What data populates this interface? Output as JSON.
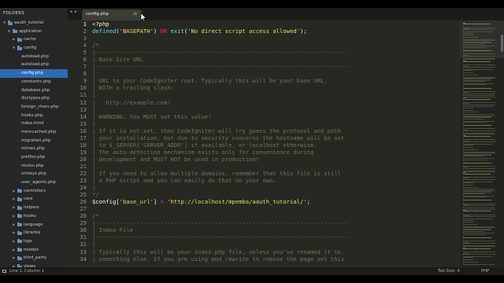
{
  "sidebar": {
    "header": "FOLDERS",
    "items": [
      {
        "label": "aauth_tutorial",
        "depth": 0,
        "open": true,
        "folder": true,
        "selected": false
      },
      {
        "label": "application",
        "depth": 1,
        "open": true,
        "folder": true,
        "selected": false
      },
      {
        "label": "cache",
        "depth": 2,
        "open": false,
        "folder": true,
        "selected": false
      },
      {
        "label": "config",
        "depth": 2,
        "open": true,
        "folder": true,
        "selected": false
      },
      {
        "label": "autoload.php",
        "depth": 3,
        "folder": false,
        "selected": false
      },
      {
        "label": "autoload.php",
        "depth": 3,
        "folder": false,
        "selected": false
      },
      {
        "label": "config.php",
        "depth": 3,
        "folder": false,
        "selected": true
      },
      {
        "label": "constants.php",
        "depth": 3,
        "folder": false,
        "selected": false
      },
      {
        "label": "database.php",
        "depth": 3,
        "folder": false,
        "selected": false
      },
      {
        "label": "doctypes.php",
        "depth": 3,
        "folder": false,
        "selected": false
      },
      {
        "label": "foreign_chars.php",
        "depth": 3,
        "folder": false,
        "selected": false
      },
      {
        "label": "hooks.php",
        "depth": 3,
        "folder": false,
        "selected": false
      },
      {
        "label": "index.html",
        "depth": 3,
        "folder": false,
        "selected": false
      },
      {
        "label": "memcached.php",
        "depth": 3,
        "folder": false,
        "selected": false
      },
      {
        "label": "migration.php",
        "depth": 3,
        "folder": false,
        "selected": false
      },
      {
        "label": "mimes.php",
        "depth": 3,
        "folder": false,
        "selected": false
      },
      {
        "label": "profiler.php",
        "depth": 3,
        "folder": false,
        "selected": false
      },
      {
        "label": "routes.php",
        "depth": 3,
        "folder": false,
        "selected": false
      },
      {
        "label": "smileys.php",
        "depth": 3,
        "folder": false,
        "selected": false
      },
      {
        "label": "user_agents.php",
        "depth": 3,
        "folder": false,
        "selected": false
      },
      {
        "label": "controllers",
        "depth": 2,
        "open": false,
        "folder": true,
        "selected": false
      },
      {
        "label": "core",
        "depth": 2,
        "open": false,
        "folder": true,
        "selected": false
      },
      {
        "label": "helpers",
        "depth": 2,
        "open": false,
        "folder": true,
        "selected": false
      },
      {
        "label": "hooks",
        "depth": 2,
        "open": false,
        "folder": true,
        "selected": false
      },
      {
        "label": "language",
        "depth": 2,
        "open": false,
        "folder": true,
        "selected": false
      },
      {
        "label": "libraries",
        "depth": 2,
        "open": false,
        "folder": true,
        "selected": false
      },
      {
        "label": "logs",
        "depth": 2,
        "open": false,
        "folder": true,
        "selected": false
      },
      {
        "label": "models",
        "depth": 2,
        "open": false,
        "folder": true,
        "selected": false
      },
      {
        "label": "third_party",
        "depth": 2,
        "open": false,
        "folder": true,
        "selected": false
      },
      {
        "label": "views",
        "depth": 2,
        "open": false,
        "folder": true,
        "selected": false
      }
    ]
  },
  "tabbar": {
    "nav": "◂ ▸",
    "tab_label": "config.php",
    "tab_close": "⊠"
  },
  "editor": {
    "active_line": 1,
    "lines": [
      {
        "n": "1",
        "parts": [
          [
            "p",
            "<?php"
          ]
        ]
      },
      {
        "n": "2",
        "parts": [
          [
            "f",
            "defined"
          ],
          [
            "p",
            "("
          ],
          [
            "s",
            "'BASEPATH'"
          ],
          [
            "p",
            ") "
          ],
          [
            "k",
            "OR"
          ],
          [
            "p",
            " "
          ],
          [
            "f",
            "exit"
          ],
          [
            "p",
            "("
          ],
          [
            "s",
            "'No direct script access allowed'"
          ],
          [
            "p",
            ");"
          ]
        ]
      },
      {
        "n": "3",
        "parts": []
      },
      {
        "n": "4",
        "parts": [
          [
            "c",
            "/*"
          ]
        ]
      },
      {
        "n": "5",
        "parts": [
          [
            "c",
            "|--------------------------------------------------------------------------"
          ]
        ]
      },
      {
        "n": "6",
        "parts": [
          [
            "c",
            "| Base Site URL"
          ]
        ]
      },
      {
        "n": "7",
        "parts": [
          [
            "c",
            "|--------------------------------------------------------------------------"
          ]
        ]
      },
      {
        "n": "8",
        "parts": [
          [
            "c",
            "|"
          ]
        ]
      },
      {
        "n": "9",
        "parts": [
          [
            "c",
            "| URL to your CodeIgniter root. Typically this will be your base URL,"
          ]
        ]
      },
      {
        "n": "10",
        "parts": [
          [
            "c",
            "| WITH a trailing slash:"
          ]
        ]
      },
      {
        "n": "11",
        "parts": [
          [
            "c",
            "|"
          ]
        ]
      },
      {
        "n": "12",
        "parts": [
          [
            "c",
            "|   http://example.com/"
          ]
        ]
      },
      {
        "n": "13",
        "parts": [
          [
            "c",
            "|"
          ]
        ]
      },
      {
        "n": "14",
        "parts": [
          [
            "c",
            "| WARNING: You MUST set this value!"
          ]
        ]
      },
      {
        "n": "15",
        "parts": [
          [
            "c",
            "|"
          ]
        ]
      },
      {
        "n": "16",
        "parts": [
          [
            "c",
            "| If it is not set, then CodeIgniter will try guess the protocol and path"
          ]
        ]
      },
      {
        "n": "17",
        "parts": [
          [
            "c",
            "| your installation, but due to security concerns the hostname will be set"
          ]
        ]
      },
      {
        "n": "18",
        "parts": [
          [
            "c",
            "| to $_SERVER['SERVER_ADDR'] if available, or localhost otherwise."
          ]
        ]
      },
      {
        "n": "19",
        "parts": [
          [
            "c",
            "| The auto-detection mechanism exists only for convenience during"
          ]
        ]
      },
      {
        "n": "20",
        "parts": [
          [
            "c",
            "| development and MUST NOT be used in production!"
          ]
        ]
      },
      {
        "n": "21",
        "parts": [
          [
            "c",
            "|"
          ]
        ]
      },
      {
        "n": "22",
        "parts": [
          [
            "c",
            "| If you need to allow multiple domains, remember that this file is still"
          ]
        ]
      },
      {
        "n": "23",
        "parts": [
          [
            "c",
            "| a PHP script and you can easily do that on your own."
          ]
        ]
      },
      {
        "n": "24",
        "parts": [
          [
            "c",
            "|"
          ]
        ]
      },
      {
        "n": "25",
        "parts": [
          [
            "c",
            "*/"
          ]
        ]
      },
      {
        "n": "26",
        "parts": [
          [
            "p",
            "$config["
          ],
          [
            "s",
            "'base_url'"
          ],
          [
            "p",
            "] "
          ],
          [
            "k",
            "="
          ],
          [
            "p",
            " "
          ],
          [
            "s",
            "'http://localhost/mpemba/aauth_tutorial/'"
          ],
          [
            "p",
            ";"
          ]
        ]
      },
      {
        "n": "27",
        "parts": []
      },
      {
        "n": "28",
        "parts": [
          [
            "c",
            "/*"
          ]
        ]
      },
      {
        "n": "29",
        "parts": [
          [
            "c",
            "|--------------------------------------------------------------------------"
          ]
        ]
      },
      {
        "n": "30",
        "parts": [
          [
            "c",
            "| Index File"
          ]
        ]
      },
      {
        "n": "31",
        "parts": [
          [
            "c",
            "|--------------------------------------------------------------------------"
          ]
        ]
      },
      {
        "n": "32",
        "parts": [
          [
            "c",
            "|"
          ]
        ]
      },
      {
        "n": "33",
        "parts": [
          [
            "c",
            "| Typically this will be your index.php file, unless you've renamed it to"
          ]
        ]
      },
      {
        "n": "34",
        "parts": [
          [
            "c",
            "| something else. If you are using mod_rewrite to remove the page set this"
          ]
        ]
      }
    ]
  },
  "status": {
    "position": "Line 1, Column 1",
    "tab_size": "Tab Size: 4",
    "syntax": "PHP"
  },
  "colors": {
    "editor_bg": "#272822",
    "sidebar_bg": "#262626",
    "selected_bg": "#2d6bb5",
    "comment": "#75715e",
    "string": "#e6db74",
    "function": "#66d9ef",
    "keyword": "#f92672"
  },
  "icons": [
    "folder-icon",
    "disclosure-arrow-icon",
    "nav-arrows-icon",
    "tab-close-icon",
    "mouse-cursor-icon",
    "status-panel-icon"
  ]
}
